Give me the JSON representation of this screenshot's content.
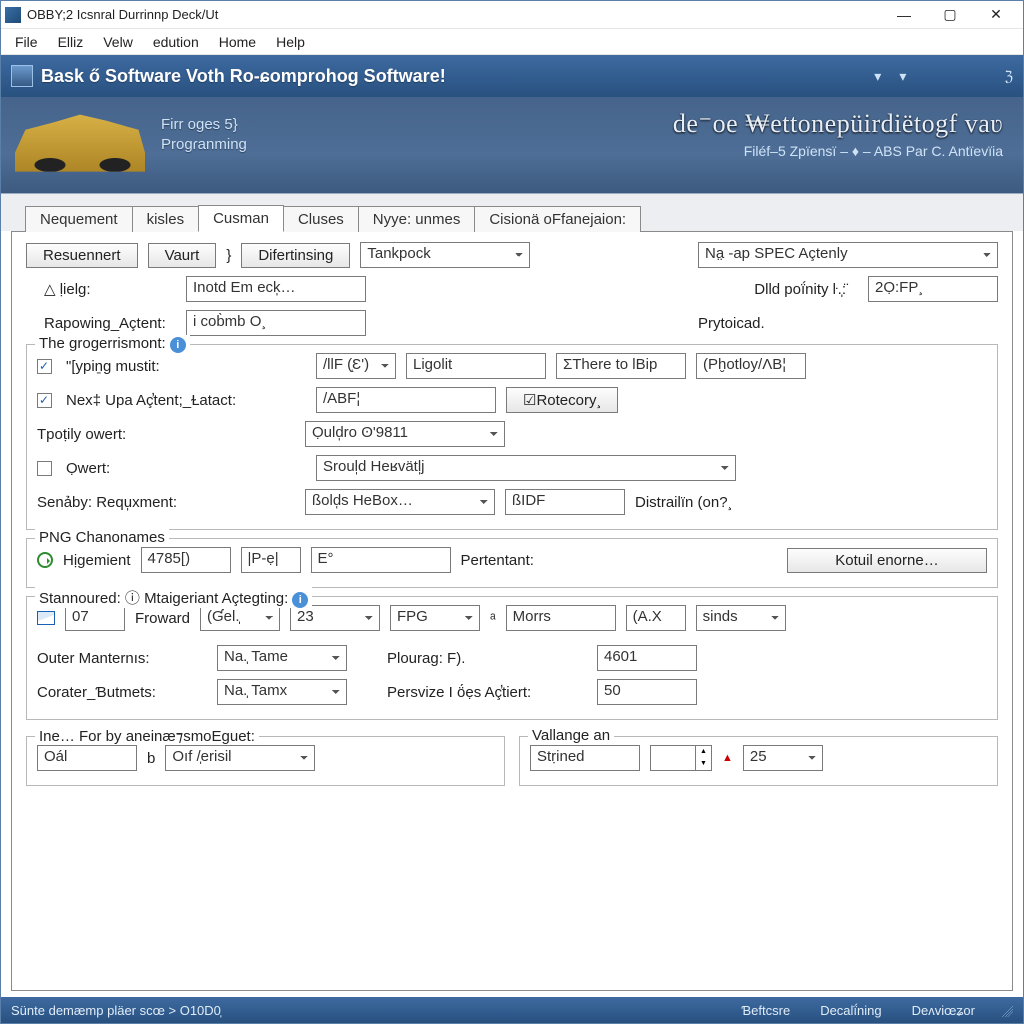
{
  "titlebar": {
    "title": "OBBY;2 Icsnral Durrinnp Deck/Ut"
  },
  "menu": {
    "file": "File",
    "elliz": "Elliz",
    "velw": "Velw",
    "edution": "edution",
    "home": "Home",
    "help": "Help"
  },
  "banner": {
    "title": "Bask ő Software Voth Ro-ɕomprohog Software!"
  },
  "hero": {
    "left_line1": "Firr  oges 5}",
    "left_line2": "Progɾanming",
    "right_big": "de⁻oe ₩ettonepüirdiëtogf vaʋ",
    "right_sub": "Filéf–5       Zpïensï – ♦ – ABS Par C. Antïevïia"
  },
  "tabs": {
    "t1": "Nequement",
    "t2": "kisles",
    "t3": "Cusman",
    "t4": "Cluses",
    "t5": "Nyye: unmes",
    "t6": "Cisionä oFfanejaion:"
  },
  "toolbar2": {
    "resuennert": "Resuennert",
    "vaurt": "Vaurt",
    "difertinsing": "Difertinsing",
    "tankpock": "Tankpock",
    "spec": "Na̤ -ap SPEC Açtenly"
  },
  "fields": {
    "lielg_label": "△  ḷielg:",
    "lielg_val": "Inotd Em  eck̩…",
    "rapowing_label": "Rapowing_Açtent:",
    "rapowing_val": "i cob̀mb O¸",
    "dlld_label": "Dlld poḯnity ŀ.̩:̈",
    "dlld_val": "2Ọ:FP¸",
    "prytocad": "Prytoicad."
  },
  "group1": {
    "legend": "The grogerrismont:",
    "typing_label": "\"[ypiṉg mustit:",
    "typing_combo": "/llF (̝Ɛ')",
    "typing_txt1": "Ligolit",
    "typing_txt2": "ƩThere to lBip",
    "typing_txt3": "(Pḫotloy/ɅB¦",
    "next_label": "Nex‡ Upa Aç̕tent;_Ɫatact:",
    "next_val": "/ABF¦",
    "rotecory": "☑Rotecory¸",
    "tpotily_label": "Tpoṭily owert:",
    "tpotily_val": "Ọuld̩ro ʘ'9811",
    "owert_label": "Ọwert:",
    "owert_val": "Sroul̩d Heʁvätl̩j",
    "senaby_label": "Senảby: Requ̩xment:",
    "senaby_val1": "ßold̩s HeBox…",
    "senaby_val2": "ßIDF",
    "distrailin": "Distrailïn (on?¸"
  },
  "group2": {
    "legend": "PNG Chanonames",
    "higemient": "Hịgemient",
    "v1": "4785[)",
    "v2": "|P-ẹ|",
    "v3": "E°",
    "pertentant": "Pertentant:",
    "kotul": "Kotuil enorne…"
  },
  "group3": {
    "legend": "Stannoured:  ⓘ  Mtaigeriant Açteɡting:",
    "v07": "07",
    "froward": "Froward",
    "gel": "(Ɠel.̩",
    "v23": "23",
    "fpg": "FPG",
    "morrs": "Morrs",
    "ax": "(A.X",
    "sinds": "sinds",
    "outer_label": "Outer Manternıs:",
    "outer_val": "Na.̩ Tame",
    "corater_label": "Corater_Ɓutmets:",
    "corater_val": "Na.̩ Tamx",
    "plourag_label": "Plouraɡ: F).",
    "plourag_val": "4601",
    "persvize_label": "Persvize I ö́ẹs Aç̕tiert:",
    "persvize_val": "50"
  },
  "group4a": {
    "legend": "Ine… For by aneinæ⁊smoEguet:",
    "val1": "Oál",
    "val2": "Oıf /̩erisil"
  },
  "group4b": {
    "legend": "Vallange an",
    "val1": "Stṛined",
    "val2": "25"
  },
  "statusbar": {
    "left": "Sünte  demæmp pläer scœ  >  O10D0̩",
    "s1": "Ɓeftcsre",
    "s2": "Decalḯning",
    "s3": "Deᴧviœʑor"
  }
}
